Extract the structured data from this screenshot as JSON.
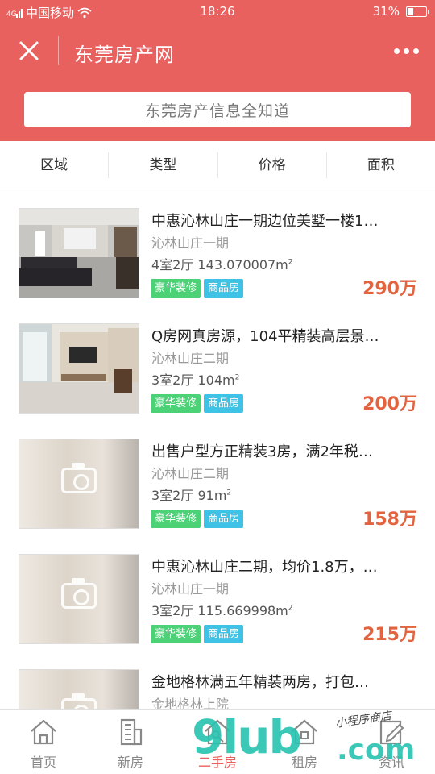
{
  "status_bar": {
    "carrier": "中国移动",
    "time": "18:26",
    "battery_percent": "31%",
    "battery_level": 0.31
  },
  "nav": {
    "title": "东莞房产网"
  },
  "search": {
    "placeholder": "东莞房产信息全知道"
  },
  "filters": [
    "区域",
    "类型",
    "价格",
    "面积"
  ],
  "listings": [
    {
      "title": "中惠沁林山庄一期边位美墅一楼1…",
      "community": "沁林山庄一期",
      "layout": "4室2厅",
      "area": "143.070007",
      "unit": "m",
      "unit_sup": "2",
      "tags": [
        "豪华装修",
        "商品房"
      ],
      "price": "290万",
      "photo": "living-room-dark"
    },
    {
      "title": "Q房网真房源，104平精装高层景…",
      "community": "沁林山庄二期",
      "layout": "3室2厅",
      "area": "104",
      "unit": "m",
      "unit_sup": "2",
      "tags": [
        "豪华装修",
        "商品房"
      ],
      "price": "200万",
      "photo": "living-room-bright"
    },
    {
      "title": "出售户型方正精装3房，满2年税…",
      "community": "沁林山庄二期",
      "layout": "3室2厅",
      "area": "91",
      "unit": "m",
      "unit_sup": "2",
      "tags": [
        "豪华装修",
        "商品房"
      ],
      "price": "158万",
      "photo": "placeholder"
    },
    {
      "title": "中惠沁林山庄二期，均价1.8万，…",
      "community": "沁林山庄一期",
      "layout": "3室2厅",
      "area": "115.669998",
      "unit": "m",
      "unit_sup": "2",
      "tags": [
        "豪华装修",
        "商品房"
      ],
      "price": "215万",
      "photo": "placeholder"
    },
    {
      "title": "金地格林满五年精装两房，打包…",
      "community": "金地格林上院",
      "layout": "",
      "area": "",
      "unit": "",
      "unit_sup": "",
      "tags": [],
      "price": "",
      "photo": "placeholder"
    }
  ],
  "tabbar": [
    {
      "label": "首页",
      "icon": "home-icon",
      "active": false
    },
    {
      "label": "新房",
      "icon": "building-icon",
      "active": false
    },
    {
      "label": "二手房",
      "icon": "key-house-icon",
      "active": true
    },
    {
      "label": "租房",
      "icon": "rent-house-icon",
      "active": false
    },
    {
      "label": "资讯",
      "icon": "edit-news-icon",
      "active": false
    }
  ],
  "watermark": {
    "main": "9lub",
    "suffix": ".com",
    "script": "小程序商店"
  },
  "colors": {
    "brand": "#e8615f",
    "price": "#e2633f",
    "tag_decoration": "#4dd177",
    "tag_type": "#3ec3e6"
  }
}
